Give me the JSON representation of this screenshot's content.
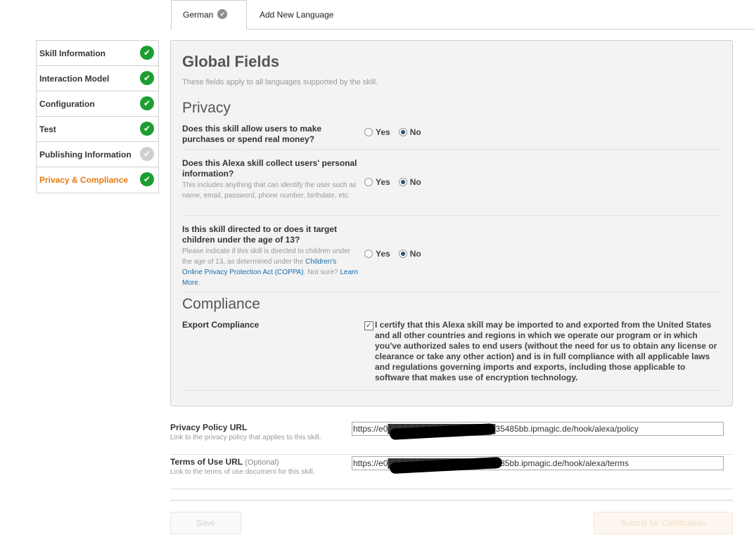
{
  "tabs": [
    {
      "label": "German",
      "active": true
    },
    {
      "label": "Add New Language",
      "active": false
    }
  ],
  "sidebar": {
    "items": [
      {
        "label": "Skill Information",
        "status": "complete"
      },
      {
        "label": "Interaction Model",
        "status": "complete"
      },
      {
        "label": "Configuration",
        "status": "complete"
      },
      {
        "label": "Test",
        "status": "complete"
      },
      {
        "label": "Publishing Information",
        "status": "pending"
      },
      {
        "label": "Privacy & Compliance",
        "status": "complete",
        "active": true
      }
    ]
  },
  "panel": {
    "title": "Global Fields",
    "subtitle": "These fields apply to all languages supported by the skill.",
    "privacy_title": "Privacy",
    "questions": [
      {
        "label": "Does this skill allow users to make purchases or spend real money?",
        "help": "",
        "yes": "Yes",
        "no": "No",
        "selected": "No"
      },
      {
        "label": "Does this Alexa skill collect users' personal information?",
        "help": "This includes anything that can identify the user such as name, email, password, phone number, birthdate, etc.",
        "yes": "Yes",
        "no": "No",
        "selected": "No"
      },
      {
        "label": "Is this skill directed to or does it target children under the age of 13?",
        "help_pre": "Please indicate if this skill is directed to children under the age of 13, as determined under the",
        "help_link": "Children's Online Privacy Protection Act (COPPA)",
        "help_mid": ". Not sure?",
        "help_link2": "Learn More",
        "help_end": ".",
        "yes": "Yes",
        "no": "No",
        "selected": "No"
      }
    ],
    "compliance_title": "Compliance",
    "export_label": "Export Compliance",
    "export_checked": true,
    "export_text": "I certify that this Alexa skill may be imported to and exported from the United States and all other countries and regions in which we operate our program or in which you've authorized sales to end users (without the need for us to obtain any license or clearance or take any other action) and is in full compliance with all applicable laws and regulations governing imports and exports, including those applicable to software that makes use of encryption technology."
  },
  "privacy_policy": {
    "label": "Privacy Policy URL",
    "help": "Link to the privacy policy that applies to this skill.",
    "value": "https://e0██████████████████35485bb.ipmagic.de/hook/alexa/policy"
  },
  "terms_of_use": {
    "label": "Terms of Use URL",
    "optional": "(Optional)",
    "help": "Link to the terms of use document for this skill.",
    "value": "https://e0██████████████████485bb.ipmagic.de/hook/alexa/terms"
  },
  "buttons": {
    "save": "Save",
    "submit": "Submit for Certification"
  }
}
